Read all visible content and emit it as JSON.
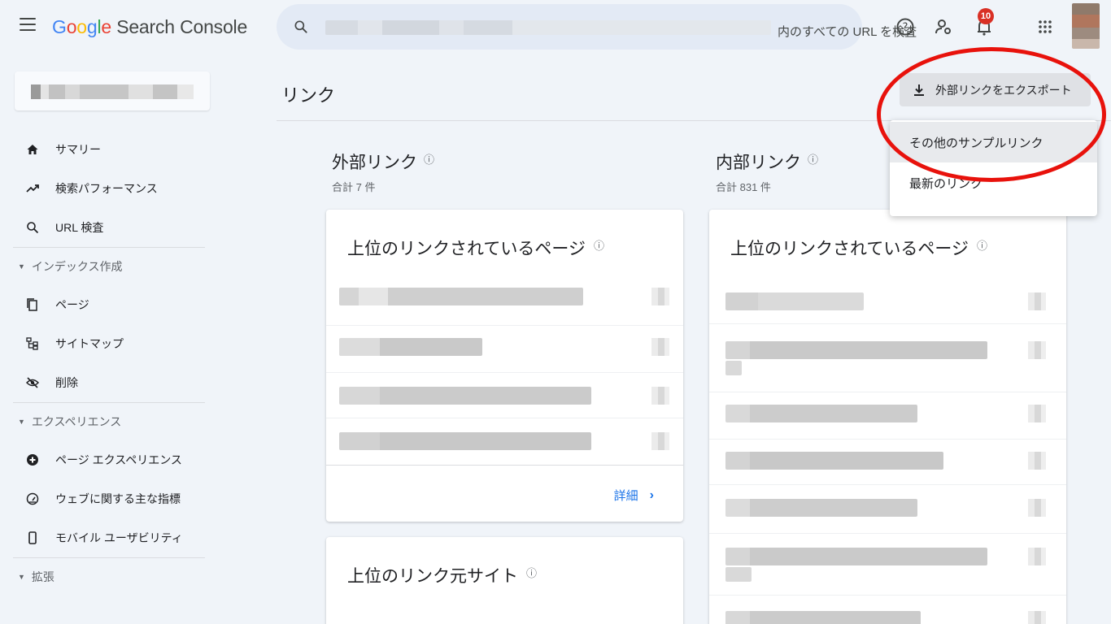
{
  "app": {
    "brand_google": [
      "G",
      "o",
      "o",
      "g",
      "l",
      "e"
    ],
    "brand_product": "Search Console"
  },
  "search": {
    "text": "内のすべての URL を検査"
  },
  "notifications": {
    "count": "10"
  },
  "sidebar": {
    "items": [
      {
        "label": "サマリー",
        "icon": "home-icon"
      },
      {
        "label": "検索パフォーマンス",
        "icon": "trending-up-icon"
      },
      {
        "label": "URL 検査",
        "icon": "search-icon"
      }
    ],
    "sections": [
      {
        "label": "インデックス作成",
        "items": [
          {
            "label": "ページ",
            "icon": "pages-icon"
          },
          {
            "label": "サイトマップ",
            "icon": "sitemap-icon"
          },
          {
            "label": "削除",
            "icon": "removal-icon"
          }
        ]
      },
      {
        "label": "エクスペリエンス",
        "items": [
          {
            "label": "ページ エクスペリエンス",
            "icon": "plus-circle-icon"
          },
          {
            "label": "ウェブに関する主な指標",
            "icon": "gauge-icon"
          },
          {
            "label": "モバイル ユーザビリティ",
            "icon": "phone-icon"
          }
        ]
      },
      {
        "label": "拡張"
      }
    ]
  },
  "page": {
    "title": "リンク"
  },
  "export": {
    "button_label": "外部リンクをエクスポート",
    "menu": [
      "その他のサンプルリンク",
      "最新のリンク"
    ]
  },
  "external": {
    "title": "外部リンク",
    "help": "?",
    "total": "合計 7 件",
    "top_pages_title": "上位のリンクされているページ",
    "details": "詳細",
    "top_sites_title": "上位のリンク元サイト"
  },
  "internal": {
    "title": "内部リンク",
    "help": "?",
    "total": "合計 831 件",
    "top_pages_title": "上位のリンクされているページ"
  },
  "colors": {
    "accent": "#1a73e8",
    "badge": "#d93025",
    "annotation": "#e8120c"
  }
}
